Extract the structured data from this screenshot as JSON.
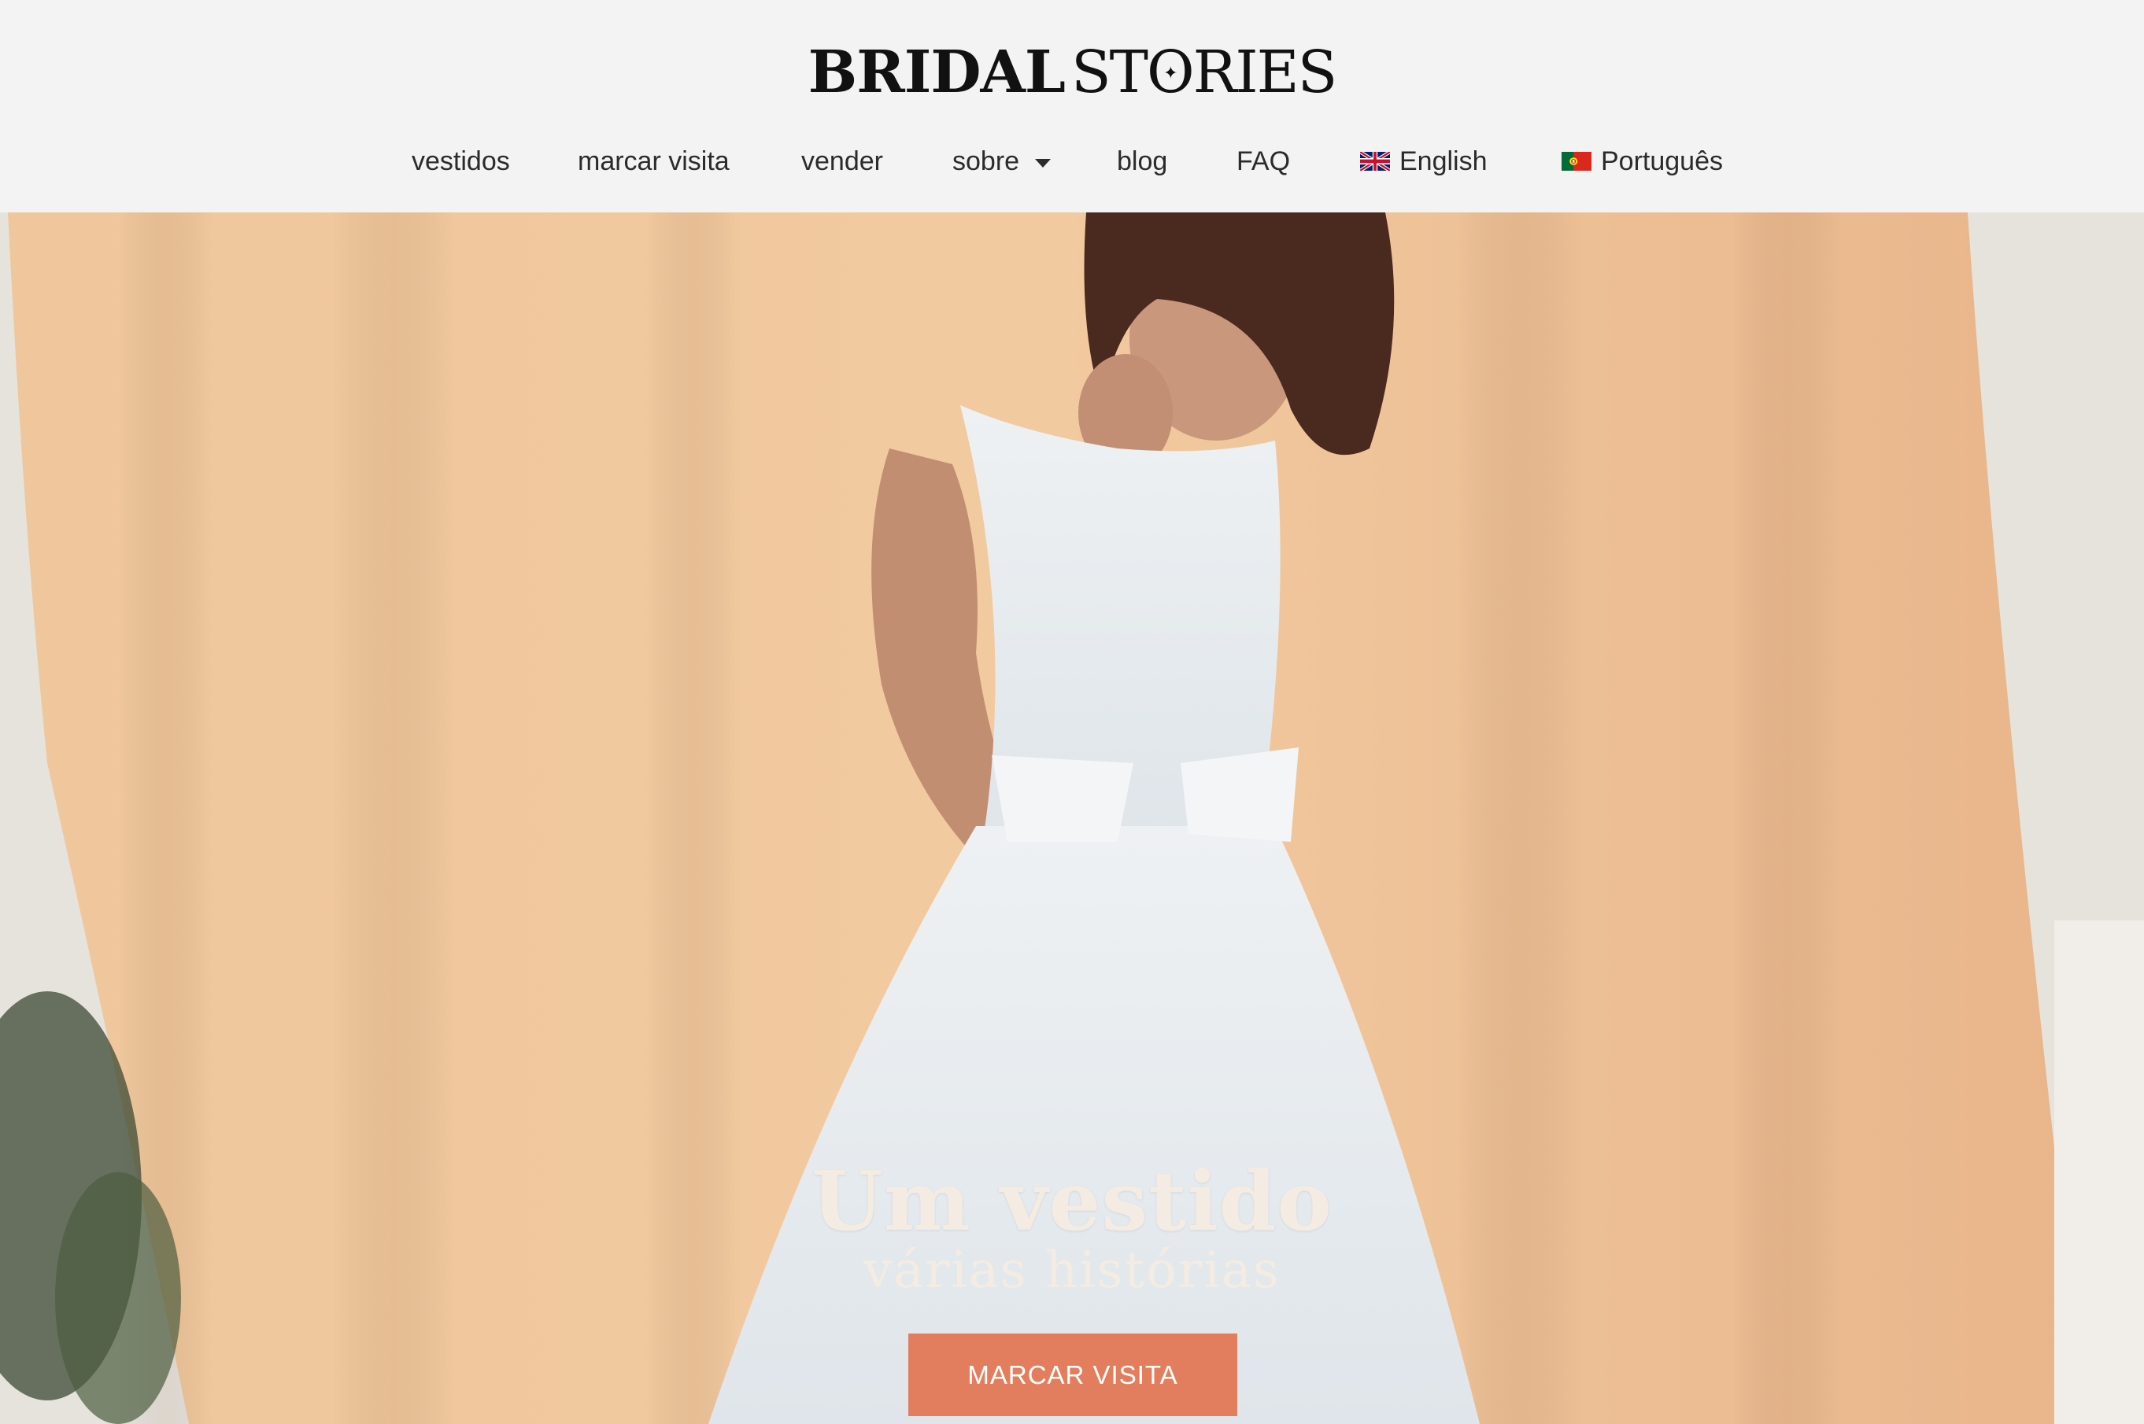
{
  "brand": {
    "word1": "BRIDAL",
    "word2_pre": "ST",
    "word2_o": "O",
    "word2_post": "RIES",
    "star": "✦"
  },
  "nav": {
    "items": [
      {
        "label": "vestidos"
      },
      {
        "label": "marcar visita"
      },
      {
        "label": "vender"
      },
      {
        "label": "sobre"
      },
      {
        "label": "blog"
      },
      {
        "label": "FAQ"
      },
      {
        "label": "English"
      },
      {
        "label": "Português"
      }
    ]
  },
  "hero": {
    "title": "Um vestido",
    "subtitle": "várias histórias",
    "cta_label": "MARCAR VISITA"
  },
  "colors": {
    "header_bg": "#f3f3f3",
    "cta": "#e27e5d",
    "hero_text": "#f4ece2",
    "backdrop": "#f1c89a"
  }
}
